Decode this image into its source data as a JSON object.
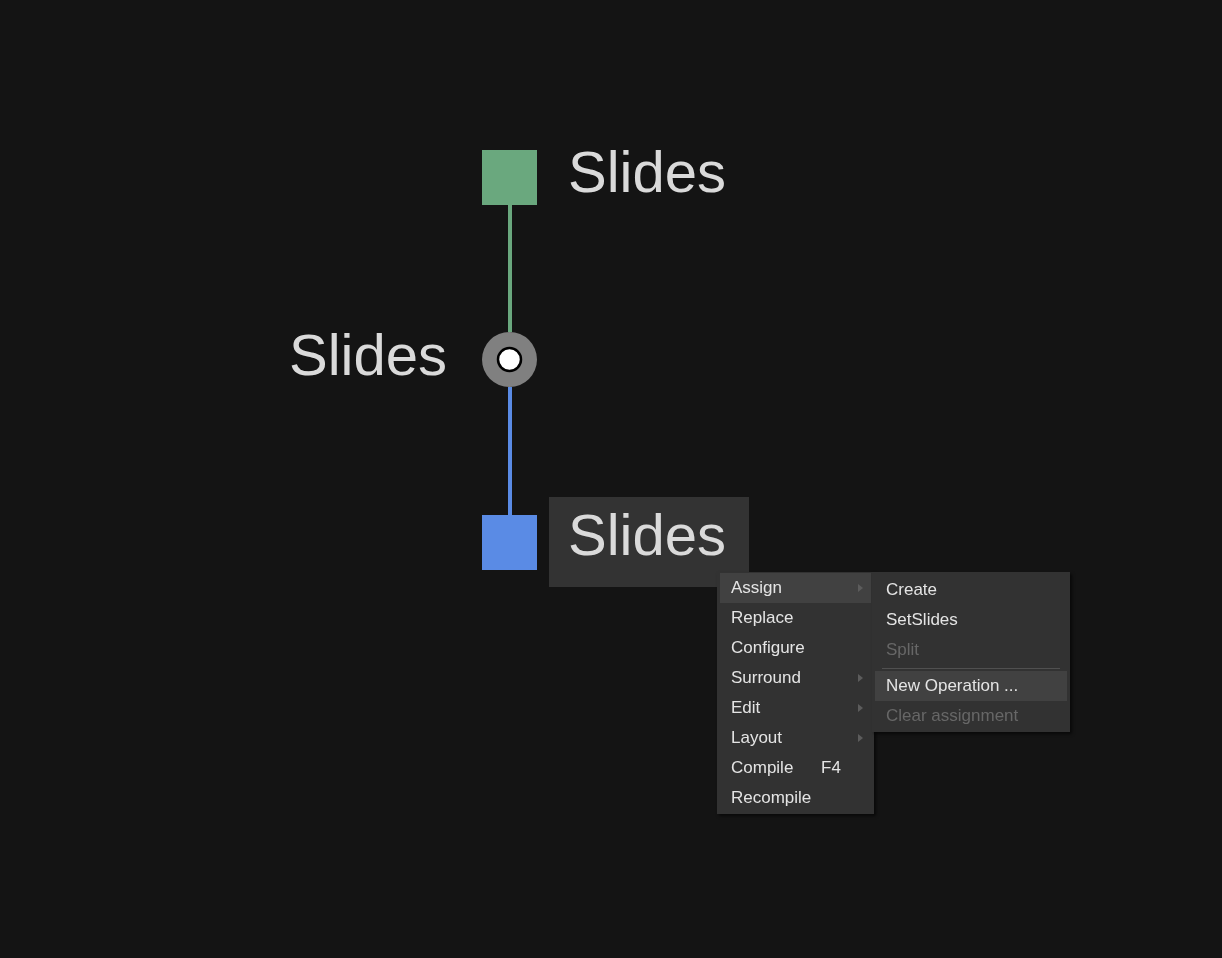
{
  "canvas": {
    "nodes": [
      {
        "kind": "square",
        "color": "#6aa87e",
        "label": "Slides",
        "selected": false
      },
      {
        "kind": "junction",
        "label": "Slides",
        "selected": false
      },
      {
        "kind": "square",
        "color": "#5a8be5",
        "label": "Slides",
        "selected": true
      }
    ],
    "connections": [
      {
        "color": "#6aa87e"
      },
      {
        "color": "#5a8be5"
      }
    ]
  },
  "context_menu": {
    "items": [
      {
        "kind": "item",
        "label": "Assign",
        "highlighted": true,
        "submenu": true
      },
      {
        "kind": "item",
        "label": "Replace",
        "highlighted": false,
        "submenu": false
      },
      {
        "kind": "item",
        "label": "Configure",
        "highlighted": false,
        "submenu": false
      },
      {
        "kind": "item",
        "label": "Surround",
        "highlighted": false,
        "submenu": true
      },
      {
        "kind": "item",
        "label": "Edit",
        "highlighted": false,
        "submenu": true
      },
      {
        "kind": "item",
        "label": "Layout",
        "highlighted": false,
        "submenu": true
      },
      {
        "kind": "item",
        "label": "Compile",
        "shortcut": "F4",
        "highlighted": false,
        "submenu": false
      },
      {
        "kind": "item",
        "label": "Recompile",
        "highlighted": false,
        "submenu": false
      }
    ]
  },
  "submenu": {
    "items": [
      {
        "kind": "item",
        "label": "Create",
        "highlighted": false,
        "disabled": false
      },
      {
        "kind": "item",
        "label": "SetSlides",
        "highlighted": false,
        "disabled": false
      },
      {
        "kind": "item",
        "label": "Split",
        "highlighted": false,
        "disabled": true
      },
      {
        "kind": "separator"
      },
      {
        "kind": "item",
        "label": "New Operation ...",
        "highlighted": true,
        "disabled": false
      },
      {
        "kind": "item",
        "label": "Clear assignment",
        "highlighted": false,
        "disabled": true
      }
    ]
  }
}
